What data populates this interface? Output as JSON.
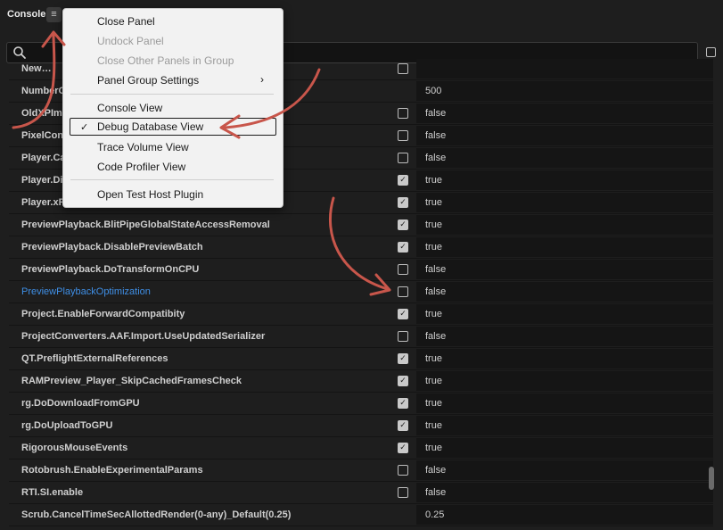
{
  "header": {
    "title": "Console",
    "menu_icon": "hamburger-menu-icon"
  },
  "search": {
    "value": "",
    "placeholder": "",
    "icon": "search-icon"
  },
  "context_menu": {
    "items": [
      {
        "label": "Close Panel",
        "enabled": true
      },
      {
        "label": "Undock Panel",
        "enabled": false
      },
      {
        "label": "Close Other Panels in Group",
        "enabled": false
      },
      {
        "label": "Panel Group Settings",
        "enabled": true,
        "submenu": true,
        "submenu_icon": "chevron-right-icon"
      },
      {
        "label": "Console View",
        "enabled": true
      },
      {
        "label": "Debug Database View",
        "enabled": true,
        "checked": true,
        "check_mark": "✓"
      },
      {
        "label": "Trace Volume View",
        "enabled": true
      },
      {
        "label": "Code Profiler View",
        "enabled": true
      },
      {
        "label": "Open Test Host Plugin",
        "enabled": true
      }
    ]
  },
  "table": {
    "rows": [
      {
        "name": "New…",
        "checkbox": false,
        "value": ""
      },
      {
        "name": "NumberO…",
        "checkbox": null,
        "value": "500"
      },
      {
        "name": "OldXPIm…",
        "checkbox": false,
        "value": "false"
      },
      {
        "name": "PixelConv…",
        "checkbox": false,
        "value": "false"
      },
      {
        "name": "Player.Ca…",
        "checkbox": false,
        "value": "false"
      },
      {
        "name": "Player.Di…",
        "checkbox": true,
        "value": "true"
      },
      {
        "name": "Player.xR…",
        "checkbox": true,
        "value": "true"
      },
      {
        "name": "PreviewPlayback.BlitPipeGlobalStateAccessRemoval",
        "checkbox": true,
        "value": "true"
      },
      {
        "name": "PreviewPlayback.DisablePreviewBatch",
        "checkbox": true,
        "value": "true"
      },
      {
        "name": "PreviewPlayback.DoTransformOnCPU",
        "checkbox": false,
        "value": "false"
      },
      {
        "name": "PreviewPlaybackOptimization",
        "checkbox": false,
        "value": "false",
        "highlight": true
      },
      {
        "name": "Project.EnableForwardCompatibity",
        "checkbox": true,
        "value": "true"
      },
      {
        "name": "ProjectConverters.AAF.Import.UseUpdatedSerializer",
        "checkbox": false,
        "value": "false"
      },
      {
        "name": "QT.PreflightExternalReferences",
        "checkbox": true,
        "value": "true"
      },
      {
        "name": "RAMPreview_Player_SkipCachedFramesCheck",
        "checkbox": true,
        "value": "true"
      },
      {
        "name": "rg.DoDownloadFromGPU",
        "checkbox": true,
        "value": "true"
      },
      {
        "name": "rg.DoUploadToGPU",
        "checkbox": true,
        "value": "true"
      },
      {
        "name": "RigorousMouseEvents",
        "checkbox": true,
        "value": "true"
      },
      {
        "name": "Rotobrush.EnableExperimentalParams",
        "checkbox": false,
        "value": "false"
      },
      {
        "name": "RTI.SI.enable",
        "checkbox": false,
        "value": "false"
      },
      {
        "name": "Scrub.CancelTimeSecAllottedRender(0-any)_Default(0.25)",
        "checkbox": null,
        "value": "0.25"
      }
    ]
  },
  "colors": {
    "background": "#1e1e1e",
    "menu_background": "#f2f2f2",
    "highlight_text": "#3f8fe6",
    "annotation_arrow": "#c8564b"
  }
}
